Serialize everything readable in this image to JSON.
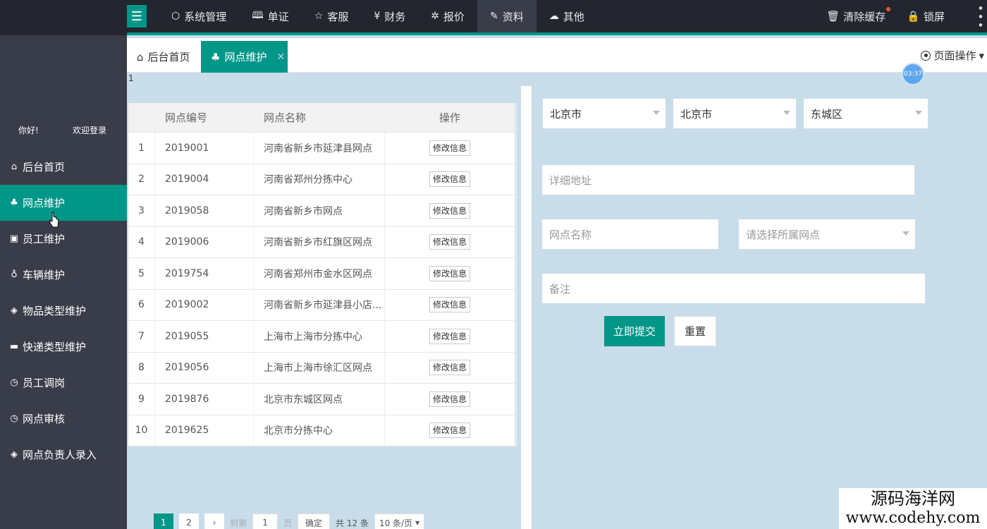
{
  "topbar": {
    "menu_toggle_glyph": "☰",
    "nav": [
      {
        "label": "系统管理",
        "icon": "⬡",
        "active": false
      },
      {
        "label": "单证",
        "icon": "🕮",
        "active": false
      },
      {
        "label": "客服",
        "icon": "☆",
        "active": false
      },
      {
        "label": "财务",
        "icon": "¥",
        "active": false
      },
      {
        "label": "报价",
        "icon": "✲",
        "active": false
      },
      {
        "label": "资料",
        "icon": "✎",
        "active": true
      },
      {
        "label": "其他",
        "icon": "☁",
        "active": false
      }
    ],
    "clear_cache": "清除缓存",
    "lock_screen": "锁屏"
  },
  "sidebar": {
    "greeting": "你好!",
    "welcome": "欢迎登录",
    "items": [
      {
        "label": "后台首页",
        "icon": "⌂",
        "active": false
      },
      {
        "label": "网点维护",
        "icon": "♣",
        "active": true
      },
      {
        "label": "员工维护",
        "icon": "▣",
        "active": false
      },
      {
        "label": "车辆维护",
        "icon": "♁",
        "active": false
      },
      {
        "label": "物品类型维护",
        "icon": "◈",
        "active": false
      },
      {
        "label": "快递类型维护",
        "icon": "▬",
        "active": false
      },
      {
        "label": "员工调岗",
        "icon": "◷",
        "active": false
      },
      {
        "label": "网点审核",
        "icon": "◷",
        "active": false
      },
      {
        "label": "网点负责人录入",
        "icon": "◈",
        "active": false
      }
    ]
  },
  "tabs": {
    "home": "后台首页",
    "current": "网点维护",
    "close_glyph": "✕",
    "page_ops": "页面操作"
  },
  "misc": {
    "small_one": "1",
    "timer": "03:37"
  },
  "table": {
    "headers": [
      "网点编号",
      "网点名称",
      "操作"
    ],
    "edit_label": "修改信息",
    "rows": [
      {
        "idx": "1",
        "code": "2019001",
        "name": "河南省新乡市延津县网点"
      },
      {
        "idx": "2",
        "code": "2019004",
        "name": "河南省郑州分拣中心"
      },
      {
        "idx": "3",
        "code": "2019058",
        "name": "河南省新乡市网点"
      },
      {
        "idx": "4",
        "code": "2019006",
        "name": "河南省新乡市红旗区网点"
      },
      {
        "idx": "5",
        "code": "2019754",
        "name": "河南省郑州市金水区网点"
      },
      {
        "idx": "6",
        "code": "2019002",
        "name": "河南省新乡市延津县小店..."
      },
      {
        "idx": "7",
        "code": "2019055",
        "name": "上海市上海市分拣中心"
      },
      {
        "idx": "8",
        "code": "2019056",
        "name": "上海市上海市徐汇区网点"
      },
      {
        "idx": "9",
        "code": "2019876",
        "name": "北京市东城区网点"
      },
      {
        "idx": "10",
        "code": "2019625",
        "name": "北京市分拣中心"
      }
    ]
  },
  "pager": {
    "pages": [
      "1",
      "2"
    ],
    "next": "›",
    "goto": "到第",
    "page_input": "1",
    "page_unit": "页",
    "confirm": "确定",
    "total": "共 12 条",
    "per_page": "10 条/页"
  },
  "form": {
    "province": "北京市",
    "city": "北京市",
    "district": "东城区",
    "address_placeholder": "详细地址",
    "name_placeholder": "网点名称",
    "parent_placeholder": "请选择所属网点",
    "remark_placeholder": "备注",
    "submit": "立即提交",
    "reset": "重置"
  },
  "watermark": {
    "line1": "源码海洋网",
    "line2": "www.codehy.com"
  },
  "colors": {
    "accent": "#009688",
    "dark": "#23262e",
    "sidebar": "#393d49"
  }
}
